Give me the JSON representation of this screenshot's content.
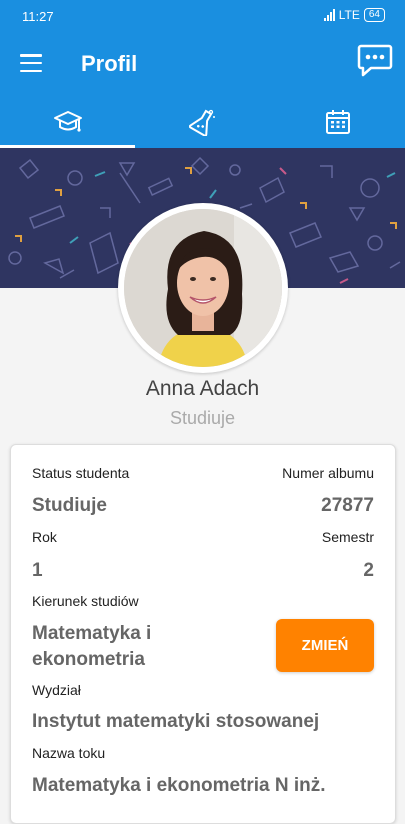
{
  "status_bar": {
    "time": "11:27",
    "network": "LTE",
    "battery": "64"
  },
  "app_bar": {
    "title": "Profil"
  },
  "tabs": [
    {
      "icon": "graduation-cap-icon",
      "active": true
    },
    {
      "icon": "flask-icon",
      "active": false
    },
    {
      "icon": "calendar-icon",
      "active": false
    }
  ],
  "profile": {
    "name": "Anna Adach",
    "status": "Studiuje"
  },
  "card": {
    "status_label": "Status studenta",
    "status_value": "Studiuje",
    "album_label": "Numer albumu",
    "album_value": "27877",
    "year_label": "Rok",
    "year_value": "1",
    "semester_label": "Semestr",
    "semester_value": "2",
    "field_label": "Kierunek studiów",
    "field_value_line1": "Matematyka i",
    "field_value_line2": "ekonometria",
    "change_button": "ZMIEŃ",
    "faculty_label": "Wydział",
    "faculty_value": "Instytut matematyki stosowanej",
    "track_label": "Nazwa toku",
    "track_value": "Matematyka i ekonometria N inż."
  },
  "colors": {
    "primary": "#1a8fe0",
    "accent": "#ff8200",
    "banner": "#2f3561"
  }
}
